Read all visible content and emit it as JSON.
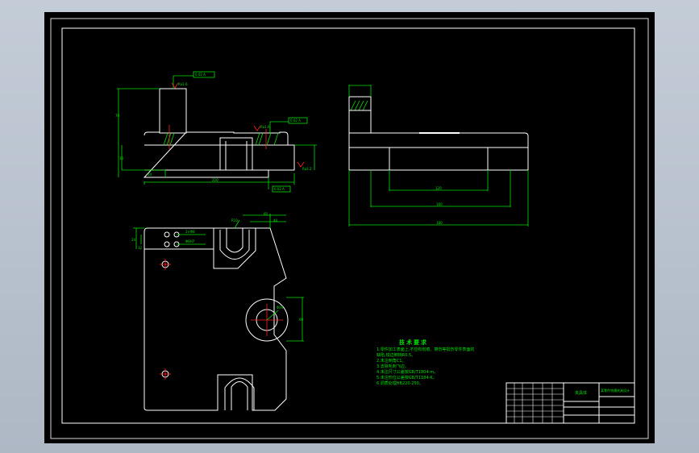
{
  "colors": {
    "background": "#000000",
    "outline": "#ffffff",
    "dimension": "#00e000",
    "centerline": "#ff2020",
    "hidden": "#00d8d8",
    "viewport": "#b9c3cf"
  },
  "tech_requirements": {
    "title": "技术要求",
    "lines": [
      "1.零件加工表面上,不应有划痕、擦伤等损伤零件表面的",
      "  缺陷,锐边倒钝R0.5。",
      "2.未注倒角C1。",
      "3.去除毛刺飞边。",
      "4.未注尺寸公差按GB/T1804-m。",
      "5.未注形位公差按GB/T1184-K。",
      "6.调质处理HB220-250。"
    ]
  },
  "title_block": {
    "part_name": "夹具体",
    "drawing_title": "某零件铣槽夹具设计"
  },
  "front_view": {
    "labels": {
      "flatness_box": "0.02 A",
      "parallel_box": "0.02 A",
      "datum_box": "0.02 A",
      "roughness_top": "Ra1.6",
      "roughness_mid": "Ra1.6",
      "roughness_bottom": "Ra3.2",
      "dim_total_width": "220",
      "dim_height": "36",
      "dim_left_height": "70",
      "dim_step": "20"
    }
  },
  "side_view": {
    "labels": {
      "dim_inner": "120",
      "dim_mid": "160",
      "dim_total": "180"
    }
  },
  "plan_view": {
    "labels": {
      "dim_top_1": "60",
      "dim_top_2": "44",
      "dim_radius": "R10",
      "dim_hole_note": "2×Φ8",
      "dim_hole_note2": "Φ8H7",
      "dim_bore": "Φ30",
      "dim_right": "60",
      "dim_left_1": "24",
      "dim_left_2": "12"
    }
  }
}
